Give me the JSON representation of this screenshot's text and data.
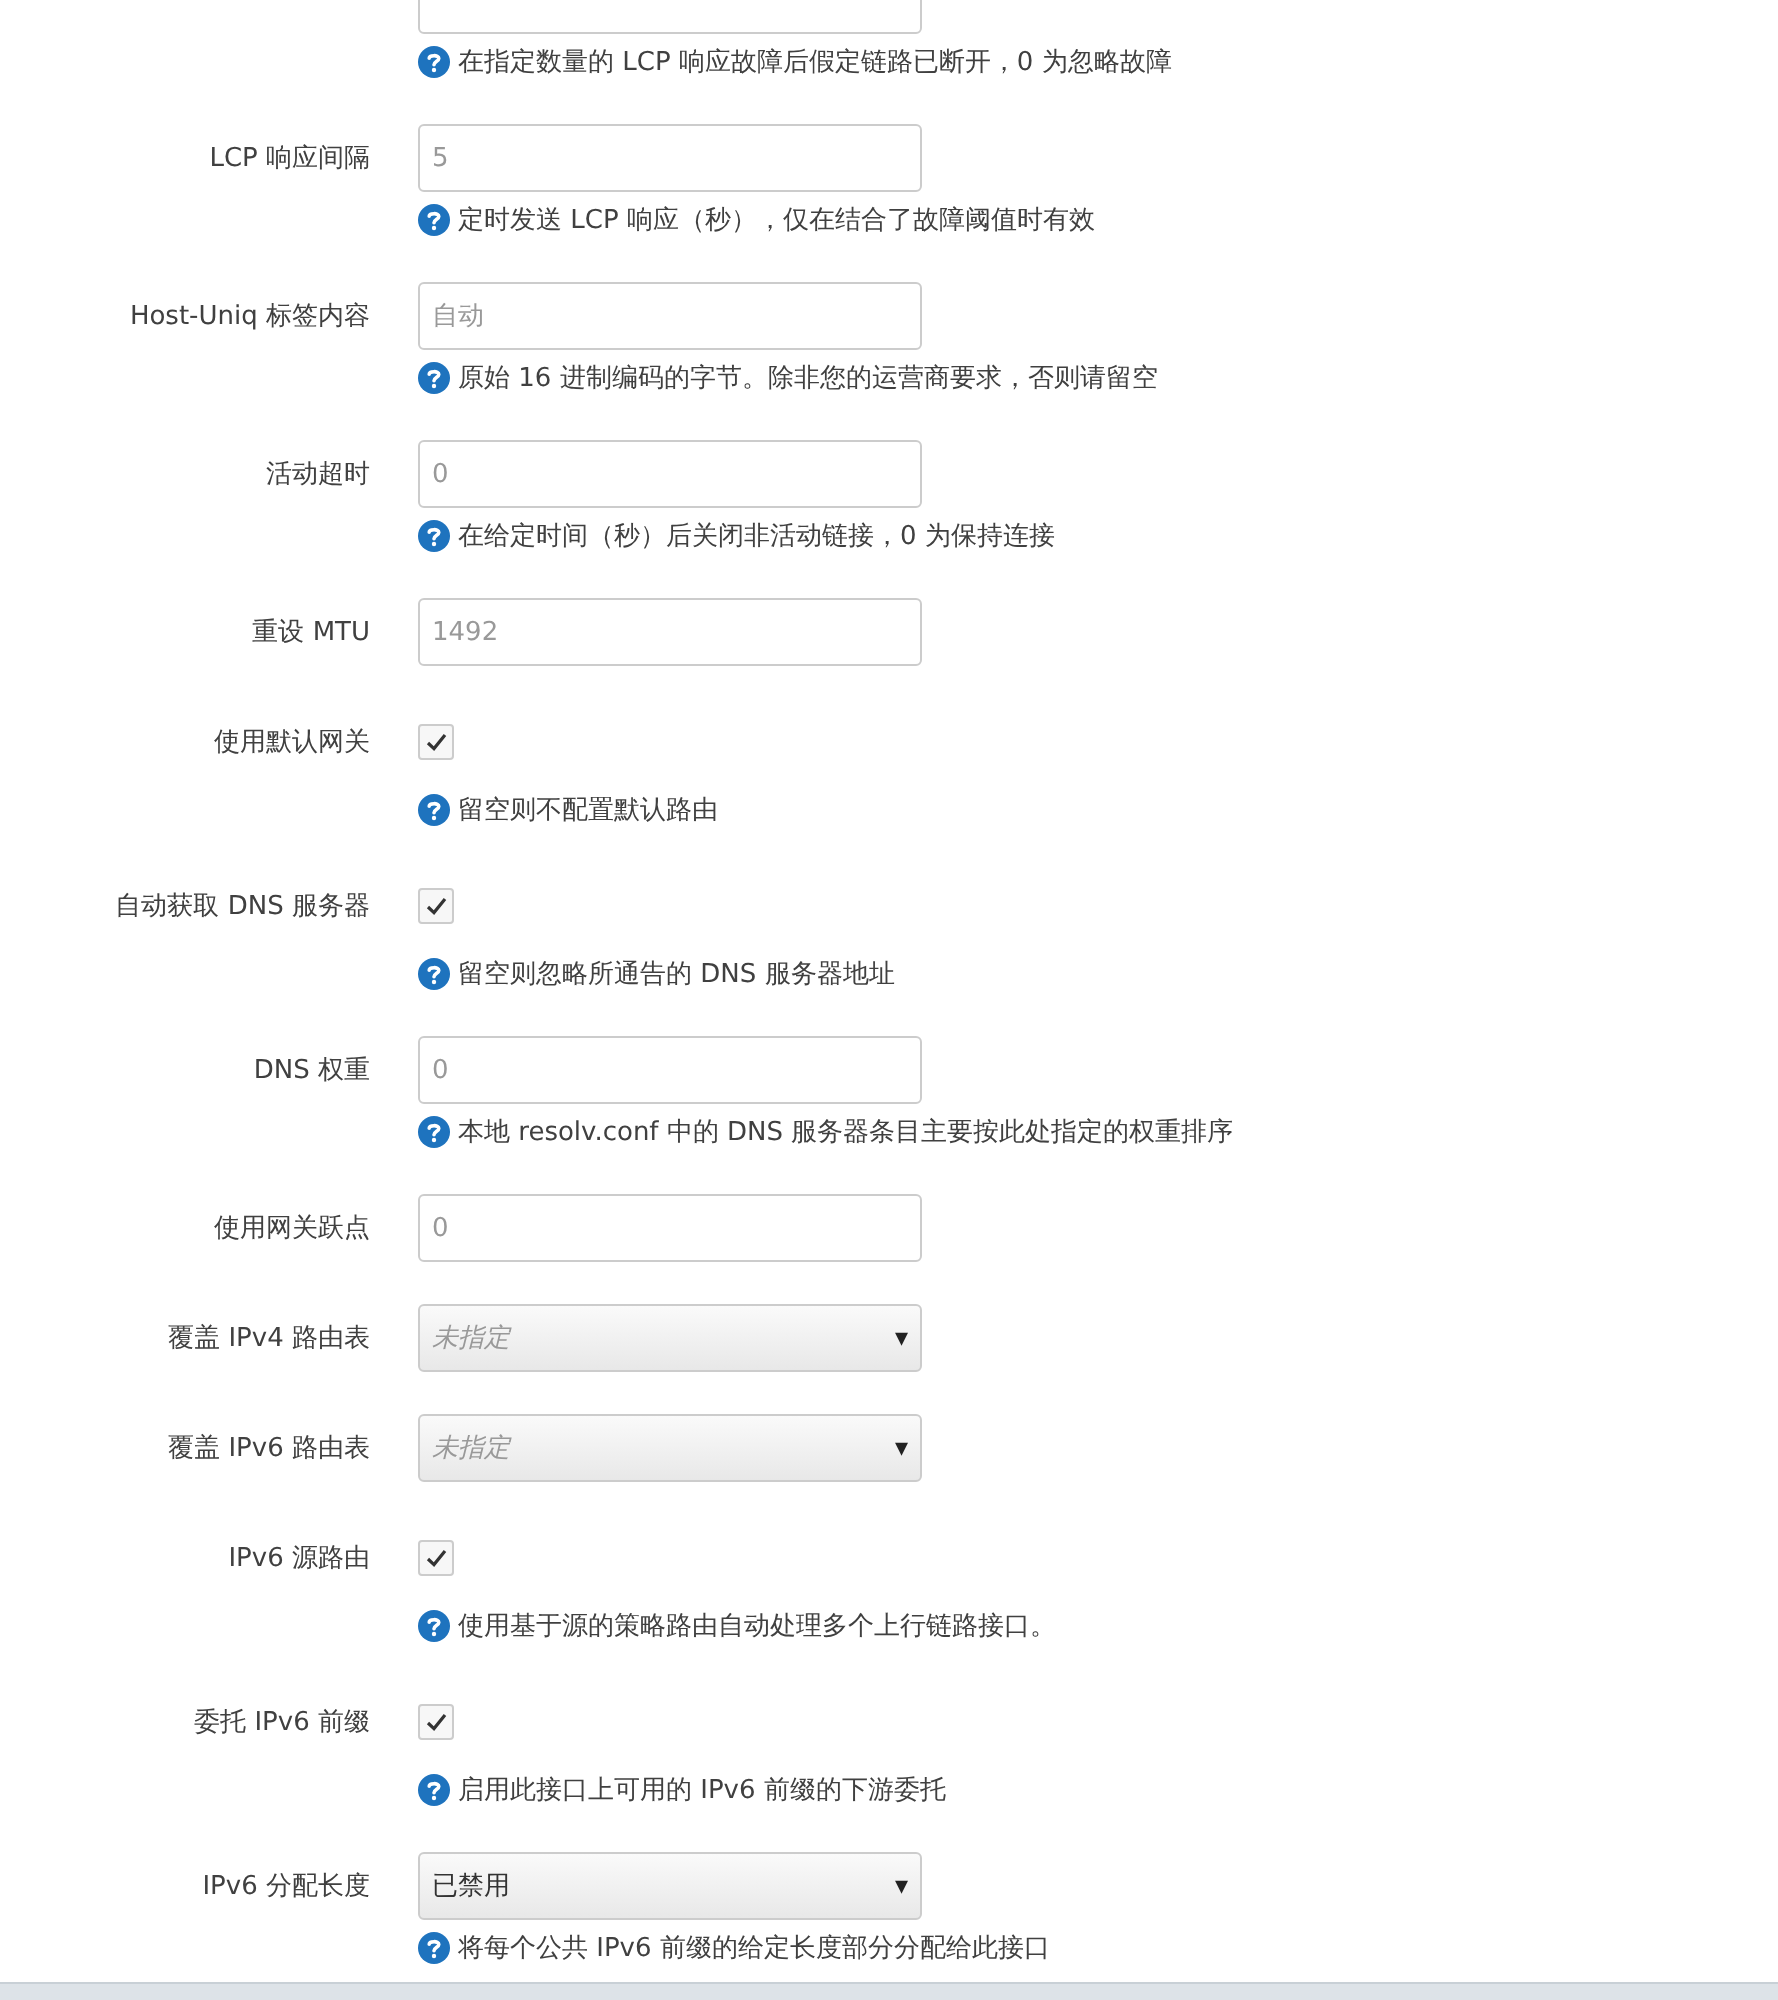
{
  "fields": [
    {
      "kind": "text",
      "help": "在指定数量的 LCP 响应故障后假定链路已断开，0 为忽略故障"
    },
    {
      "label": "LCP 响应间隔",
      "kind": "text",
      "placeholder": "5",
      "help": "定时发送 LCP 响应（秒），仅在结合了故障阈值时有效"
    },
    {
      "label": "Host-Uniq 标签内容",
      "kind": "text",
      "placeholder": "自动",
      "help": "原始 16 进制编码的字节。除非您的运营商要求，否则请留空"
    },
    {
      "label": "活动超时",
      "kind": "text",
      "placeholder": "0",
      "help": "在给定时间（秒）后关闭非活动链接，0 为保持连接"
    },
    {
      "label": "重设 MTU",
      "kind": "text",
      "placeholder": "1492"
    },
    {
      "label": "使用默认网关",
      "kind": "checkbox",
      "checked": true,
      "help": "留空则不配置默认路由"
    },
    {
      "label": "自动获取 DNS 服务器",
      "kind": "checkbox",
      "checked": true,
      "help": "留空则忽略所通告的 DNS 服务器地址"
    },
    {
      "label": "DNS 权重",
      "kind": "text",
      "placeholder": "0",
      "help": "本地 resolv.conf 中的 DNS 服务器条目主要按此处指定的权重排序"
    },
    {
      "label": "使用网关跃点",
      "kind": "text",
      "placeholder": "0"
    },
    {
      "label": "覆盖 IPv4 路由表",
      "kind": "select",
      "value": "未指定",
      "unset": true,
      "caret": "▾"
    },
    {
      "label": "覆盖 IPv6 路由表",
      "kind": "select",
      "value": "未指定",
      "unset": true,
      "caret": "▾"
    },
    {
      "label": "IPv6 源路由",
      "kind": "checkbox",
      "checked": true,
      "help": "使用基于源的策略路由自动处理多个上行链路接口。"
    },
    {
      "label": "委托 IPv6 前缀",
      "kind": "checkbox",
      "checked": true,
      "help": "启用此接口上可用的 IPv6 前缀的下游委托"
    },
    {
      "label": "IPv6 分配长度",
      "kind": "select",
      "value": "已禁用",
      "unset": false,
      "caret": "▾",
      "help": "将每个公共 IPv6 前缀的给定长度部分分配给此接口"
    }
  ]
}
